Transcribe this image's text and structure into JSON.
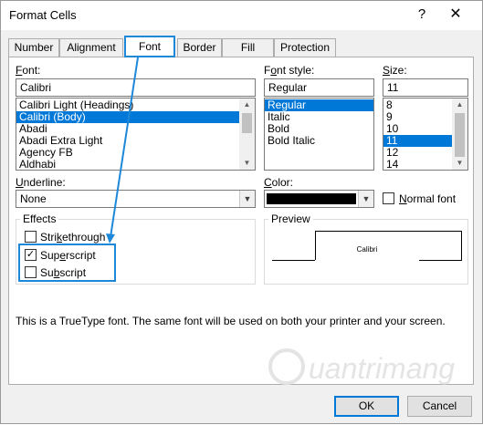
{
  "dialog": {
    "title": "Format Cells",
    "help_label": "?",
    "close_label": "✕"
  },
  "tabs": [
    {
      "label": "Number"
    },
    {
      "label": "Alignment"
    },
    {
      "label": "Font"
    },
    {
      "label": "Border"
    },
    {
      "label": "Fill"
    },
    {
      "label": "Protection"
    }
  ],
  "font": {
    "label_u": "F",
    "label_rest": "ont:",
    "value": "Calibri",
    "items": [
      "Calibri Light (Headings)",
      "Calibri (Body)",
      "Abadi",
      "Abadi Extra Light",
      "Agency FB",
      "Aldhabi"
    ],
    "selected_index": 1
  },
  "font_style": {
    "label_pre": "F",
    "label_u": "o",
    "label_rest": "nt style:",
    "value": "Regular",
    "items": [
      "Regular",
      "Italic",
      "Bold",
      "Bold Italic"
    ],
    "selected_index": 0
  },
  "size": {
    "label_u": "S",
    "label_rest": "ize:",
    "value": "11",
    "items": [
      "8",
      "9",
      "10",
      "11",
      "12",
      "14"
    ],
    "selected_index": 3
  },
  "underline": {
    "label_u": "U",
    "label_rest": "nderline:",
    "value": "None"
  },
  "color": {
    "label_u": "C",
    "label_rest": "olor:",
    "swatch": "#000000"
  },
  "normal_font": {
    "label_u": "N",
    "label_rest": "ormal font",
    "checked": false
  },
  "effects": {
    "title": "Effects",
    "strikethrough": {
      "label_pre": "Stri",
      "label_u": "k",
      "label_rest": "ethrough",
      "checked": false
    },
    "superscript": {
      "label_pre": "Sup",
      "label_u": "e",
      "label_rest": "rscript",
      "checked": true,
      "mark": "✓"
    },
    "subscript": {
      "label_pre": "Su",
      "label_u": "b",
      "label_rest": "script",
      "checked": false
    }
  },
  "preview": {
    "title": "Preview",
    "sample": "Calibri"
  },
  "info_text": "This is a TrueType font.  The same font will be used on both your printer and your screen.",
  "buttons": {
    "ok": "OK",
    "cancel": "Cancel"
  },
  "watermark": "uantrimang",
  "highlight_color": "#1e88d8"
}
